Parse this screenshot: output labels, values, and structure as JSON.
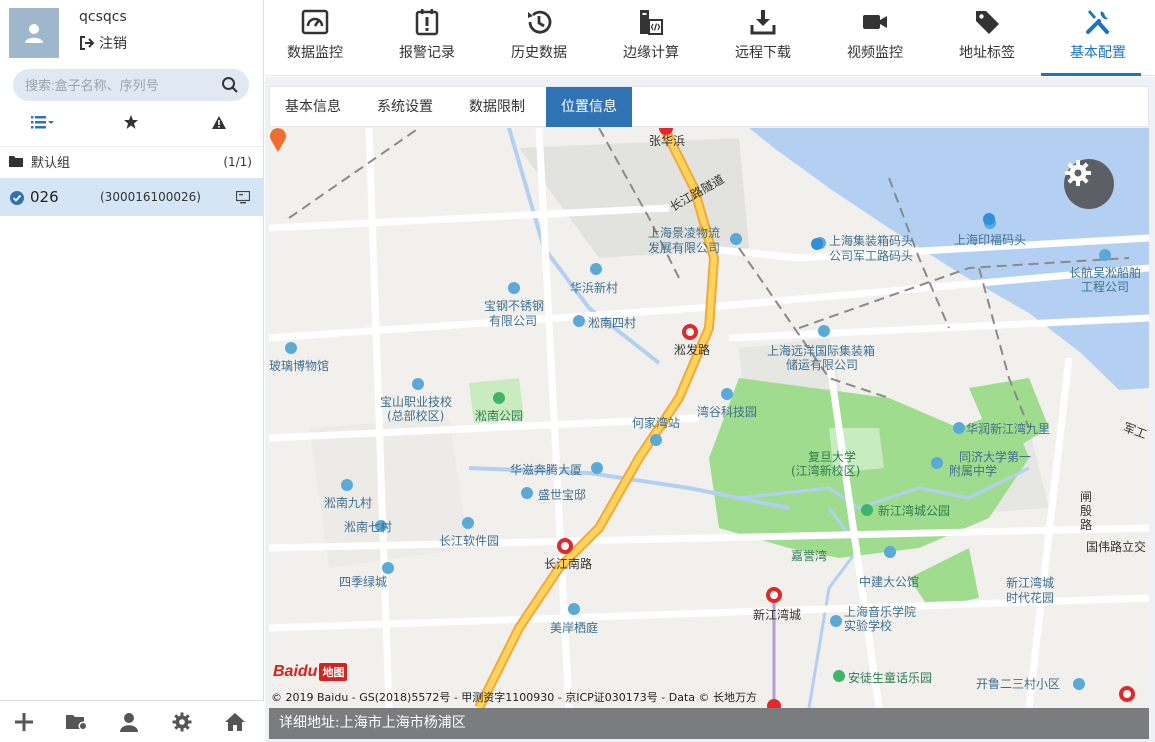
{
  "user": {
    "name": "qcsqcs",
    "logout_label": "注销"
  },
  "search": {
    "placeholder": "搜索:盒子名称、序列号"
  },
  "group": {
    "name": "默认组",
    "count": "(1/1)"
  },
  "device": {
    "id": "026",
    "serial": "(300016100026)"
  },
  "nav": {
    "items": [
      {
        "label": "数据监控",
        "icon": "monitor-icon"
      },
      {
        "label": "报警记录",
        "icon": "alarm-icon"
      },
      {
        "label": "历史数据",
        "icon": "history-icon"
      },
      {
        "label": "边缘计算",
        "icon": "code-icon"
      },
      {
        "label": "远程下载",
        "icon": "download-icon"
      },
      {
        "label": "视频监控",
        "icon": "video-icon"
      },
      {
        "label": "地址标签",
        "icon": "tag-icon"
      },
      {
        "label": "基本配置",
        "icon": "tools-icon"
      }
    ],
    "active": "基本配置"
  },
  "subtabs": {
    "items": [
      "基本信息",
      "系统设置",
      "数据限制",
      "位置信息"
    ],
    "active": "位置信息"
  },
  "map": {
    "baidu_word": "Baidu",
    "baidu_map_word": "地图",
    "copyright": "© 2019 Baidu - GS(2018)5572号 - 甲测资字1100930 - 京ICP证030173号 - Data © 长地万方",
    "labels": {
      "zhanghua": "张华浜",
      "changjiang_tunnel": "长江路隧道",
      "jingling_1": "上海景凌物流",
      "jingling_2": "发展有限公司",
      "container_1": "上海集装箱码头",
      "container_2": "公司军工路码头",
      "yinfu": "上海印福码头",
      "changhang_1": "长航吴淞船舶",
      "changhang_2": "工程公司",
      "huabin": "华浜新村",
      "baogang_1": "宝钢不锈钢",
      "baogang_2": "有限公司",
      "songnan4": "淞南四村",
      "songfa": "淞发路",
      "glass": "玻璃博物馆",
      "yuanyang_1": "上海远洋国际集装箱",
      "yuanyang_2": "储运有限公司",
      "baoshan_1": "宝山职业技校",
      "baoshan_2": "(总部校区)",
      "songnan_park": "淞南公园",
      "hejiawan": "何家湾站",
      "science_park": "湾谷科技园",
      "huarun": "华润新江湾九里",
      "fudan_1": "复旦大学",
      "fudan_2": "(江湾新校区)",
      "tongji_1": "同济大学第一",
      "tongji_2": "附属中学",
      "huazi": "华滋奔腾大厦",
      "shengshi": "盛世宝邸",
      "songnan9": "淞南九村",
      "xinjiangwan_park": "新江湾城公园",
      "zhabei_1": "闸",
      "zhabei_2": "殷",
      "zhabei_3": "路",
      "songnan7": "淞南七村",
      "changjiang_soft": "长江软件园",
      "jiayu": "嘉誉湾",
      "guowei": "国伟路立交",
      "changjiangnan": "长江南路",
      "zhongjian": "中建大公馆",
      "xinjiangwan_city": "新江湾城",
      "xjw_garden_1": "新江湾城",
      "xjw_garden_2": "时代花园",
      "siji": "四季绿城",
      "music_1": "上海音乐学院",
      "music_2": "实验学校",
      "meian": "美岸栖庭",
      "antu": "安徒生童话乐园",
      "kailu": "开鲁二三村小区",
      "junggong": "军工"
    }
  },
  "address": {
    "label": "详细地址:",
    "value": "上海市上海市杨浦区"
  }
}
